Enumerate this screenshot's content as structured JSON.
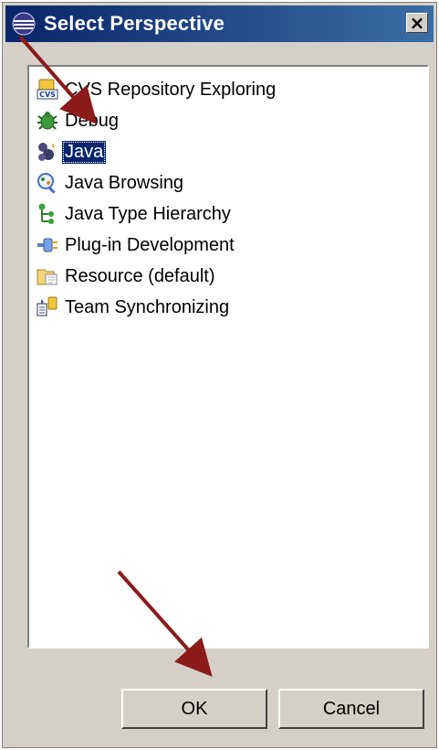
{
  "window": {
    "title": "Select Perspective",
    "close_label": "×"
  },
  "perspectives": [
    {
      "label": "CVS Repository Exploring",
      "icon": "cvs-repository-icon",
      "selected": false
    },
    {
      "label": "Debug",
      "icon": "bug-icon",
      "selected": false
    },
    {
      "label": "Java",
      "icon": "java-perspective-icon",
      "selected": true
    },
    {
      "label": "Java Browsing",
      "icon": "java-browsing-icon",
      "selected": false
    },
    {
      "label": "Java Type Hierarchy",
      "icon": "type-hierarchy-icon",
      "selected": false
    },
    {
      "label": "Plug-in Development",
      "icon": "plugin-icon",
      "selected": false
    },
    {
      "label": "Resource (default)",
      "icon": "folder-icon",
      "selected": false
    },
    {
      "label": "Team Synchronizing",
      "icon": "synchronize-icon",
      "selected": false
    }
  ],
  "buttons": {
    "ok": "OK",
    "cancel": "Cancel"
  },
  "colors": {
    "title_bar": "#0a246a",
    "selection": "#0a246a",
    "annotation_arrow": "#8b1a1a"
  }
}
